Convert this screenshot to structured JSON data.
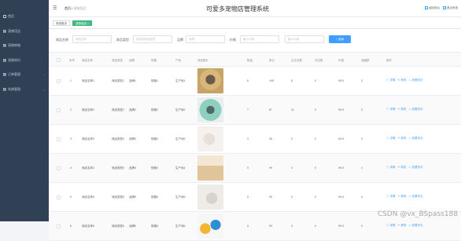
{
  "sidebar": {
    "items": [
      {
        "label": "首页",
        "icon": "home-icon"
      },
      {
        "label": "宠物用品",
        "icon": "grid-icon"
      },
      {
        "label": "宠物商城",
        "icon": "grid-icon"
      },
      {
        "label": "宠物知识",
        "icon": "grid-icon"
      },
      {
        "label": "订单管理",
        "icon": "grid-icon"
      },
      {
        "label": "系统管理",
        "icon": "grid-icon"
      }
    ]
  },
  "header": {
    "breadcrumb_home": "首页",
    "breadcrumb_sep": "/",
    "breadcrumb_current": "宠物用品",
    "title": "可爱多宠物店管理系统",
    "backend_label": "返回前台",
    "logout_label": "退出系统"
  },
  "tags": {
    "home": "系统首页",
    "current": "宠物用品 ×"
  },
  "search": {
    "name_label": "商品名称",
    "name_placeholder": "商品名称",
    "type_label": "商品类型",
    "type_placeholder": "请选择商品类型",
    "brand_label": "品牌",
    "brand_placeholder": "品牌",
    "price_label": "价格",
    "min_placeholder": "最小价格",
    "max_placeholder": "最大价格",
    "button": "查询"
  },
  "table": {
    "headers": [
      "序号",
      "商品名称",
      "商品类型",
      "品牌",
      "规格",
      "产地",
      "商品图片",
      "数量",
      "单价",
      "点击次数",
      "评论数",
      "价格",
      "收藏数",
      "操作"
    ],
    "rows": [
      {
        "idx": "1",
        "name": "商品名称1",
        "type": "商品类型1",
        "brand": "品牌1",
        "spec": "规格1",
        "origin": "生产地1",
        "qty": "6",
        "unit": "105",
        "clicks": "8",
        "comments": "0",
        "price": "99.9",
        "fav": "0"
      },
      {
        "idx": "2",
        "name": "商品名称2",
        "type": "商品类型2",
        "brand": "品牌2",
        "spec": "规格2",
        "origin": "生产地2",
        "qty": "7",
        "unit": "87",
        "clicks": "11",
        "comments": "0",
        "price": "99.9",
        "fav": "2"
      },
      {
        "idx": "3",
        "name": "商品名称3",
        "type": "商品类型3",
        "brand": "品牌3",
        "spec": "规格3",
        "origin": "生产地3",
        "qty": "3",
        "unit": "99",
        "clicks": "0",
        "comments": "0",
        "price": "99.9",
        "fav": "0"
      },
      {
        "idx": "4",
        "name": "商品名称4",
        "type": "商品类型4",
        "brand": "品牌4",
        "spec": "规格4",
        "origin": "生产地4",
        "qty": "3",
        "unit": "99",
        "clicks": "3",
        "comments": "0",
        "price": "99.9",
        "fav": "1"
      },
      {
        "idx": "5",
        "name": "商品名称5",
        "type": "商品类型5",
        "brand": "品牌5",
        "spec": "规格5",
        "origin": "生产地5",
        "qty": "3",
        "unit": "99",
        "clicks": "0",
        "comments": "0",
        "price": "99.9",
        "fav": "4"
      },
      {
        "idx": "6",
        "name": "商品名称6",
        "type": "商品类型6",
        "brand": "品牌6",
        "spec": "规格6",
        "origin": "生产地6",
        "qty": "3",
        "unit": "99",
        "clicks": "0",
        "comments": "0",
        "price": "99.9",
        "fav": "0"
      }
    ],
    "ops": {
      "detail": "详情",
      "edit": "修改",
      "review": "查看评论"
    }
  },
  "watermark": "CSDN @vx_BSpass188",
  "colors": {
    "sidebar": "#304156",
    "primary": "#409eff",
    "tag_active": "#42b983"
  }
}
